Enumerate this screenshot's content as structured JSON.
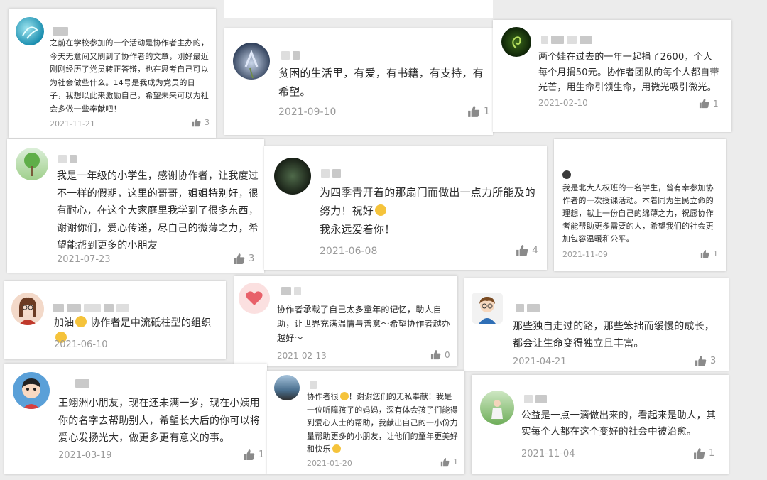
{
  "colors": {
    "background": "#ececec",
    "card": "#ffffff",
    "text": "#2b2b2b",
    "meta": "#9a9a9a",
    "blurred_name": "#c9c9c9"
  },
  "icons": {
    "like": "thumbs-up-icon"
  },
  "comments": [
    {
      "text": "之前在学校参加的一个活动是协作者主办的，今天无意间又刷到了协作者的文章，刚好最近刚刚经历了党员转正答辩，也在思考自己可以为社会做些什么。14号是我成为党员的日子，我想以此来激励自己，希望未来可以为社会多做一些奉献吧！",
      "date": "2021-11-21",
      "likes": "3"
    },
    {
      "text": "贫困的生活里，有爱，有书籍，有支持，有希望。",
      "date": "2021-09-10",
      "likes": "1"
    },
    {
      "text": "两个娃在过去的一年一起捐了2600，个人每个月捐50元。协作者团队的每个人都自带光芒，用生命引领生命，用微光吸引微光。",
      "date": "2021-02-10",
      "likes": "1"
    },
    {
      "text": "我是一年级的小学生，感谢协作者，让我度过不一样的假期，这里的哥哥，姐姐特别好，很有耐心，在这个大家庭里我学到了很多东西，谢谢你们，爱心传递，尽自己的微薄之力，希望能帮到更多的小朋友",
      "date": "2021-07-23",
      "likes": "3"
    },
    {
      "text": "为四季青开着的那扇门而做出一点力所能及的努力！祝好",
      "text2": "我永远爱着你！",
      "date": "2021-06-08",
      "likes": "4"
    },
    {
      "text": "我是北大人权班的一名学生，曾有幸参加协作者的一次授课活动。本着同为生民立命的理想，献上一份自己的绵薄之力，祝愿协作者能帮助更多需要的人，希望我们的社会更加包容温暖和公平。",
      "date": "2021-11-09",
      "likes": "1"
    },
    {
      "text_a": "加油",
      "text_b": "协作者是中流砥柱型的组织",
      "date": "2021-06-10",
      "likes": ""
    },
    {
      "text": "协作者承载了自己太多童年的记忆，助人自助，让世界充满温情与善意～希望协作者越办越好～",
      "date": "2021-02-13",
      "likes": "0"
    },
    {
      "text": "那些独自走过的路，那些笨拙而缓慢的成长，都会让生命变得独立且丰富。",
      "date": "2021-04-21",
      "likes": "3"
    },
    {
      "text": "王翊洲小朋友，现在还未满一岁，现在小姨用你的名字去帮助别人，希望长大后的你可以将爱心发扬光大，做更多更有意义的事。",
      "date": "2021-03-19",
      "likes": "1"
    },
    {
      "text_a": "协作者很",
      "text_b": "！谢谢您们的无私奉献！我是一位听障孩子的妈妈，深有体会孩子们能得到爱心人士的帮助，我献出自己的一小份力量帮助更多的小朋友，让他们的童年更美好和快乐",
      "date": "2021-01-20",
      "likes": "1"
    },
    {
      "text": "公益是一点一滴做出来的，看起来是助人，其实每个人都在这个变好的社会中被治愈。",
      "date": "2021-11-04",
      "likes": "1"
    }
  ]
}
